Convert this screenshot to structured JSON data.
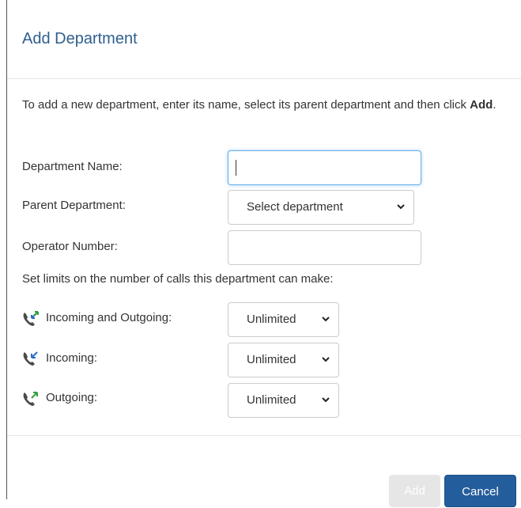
{
  "dialog": {
    "title": "Add Department",
    "intro_prefix": "To add a new department, enter its name, select its parent department and then click ",
    "intro_bold": "Add",
    "intro_suffix": "."
  },
  "form": {
    "department_name_label": "Department Name:",
    "department_name_value": "",
    "parent_department_label": "Parent Department:",
    "parent_department_value": "Select department",
    "operator_number_label": "Operator Number:",
    "operator_number_value": "",
    "limits_heading": "Set limits on the number of calls this department can make:"
  },
  "limits": [
    {
      "label": "Incoming and Outgoing:",
      "value": "Unlimited",
      "icon": "phone-both-icon"
    },
    {
      "label": "Incoming:",
      "value": "Unlimited",
      "icon": "phone-incoming-icon"
    },
    {
      "label": "Outgoing:",
      "value": "Unlimited",
      "icon": "phone-outgoing-icon"
    }
  ],
  "buttons": {
    "add_label": "Add",
    "cancel_label": "Cancel"
  },
  "colors": {
    "title": "#2f5f8e",
    "primary_button": "#245d9b",
    "disabled_button": "#e6e6e6",
    "phone_icon": "#4a4a4a",
    "arrow_green": "#2e9e3e",
    "arrow_blue": "#2b6cc4"
  }
}
